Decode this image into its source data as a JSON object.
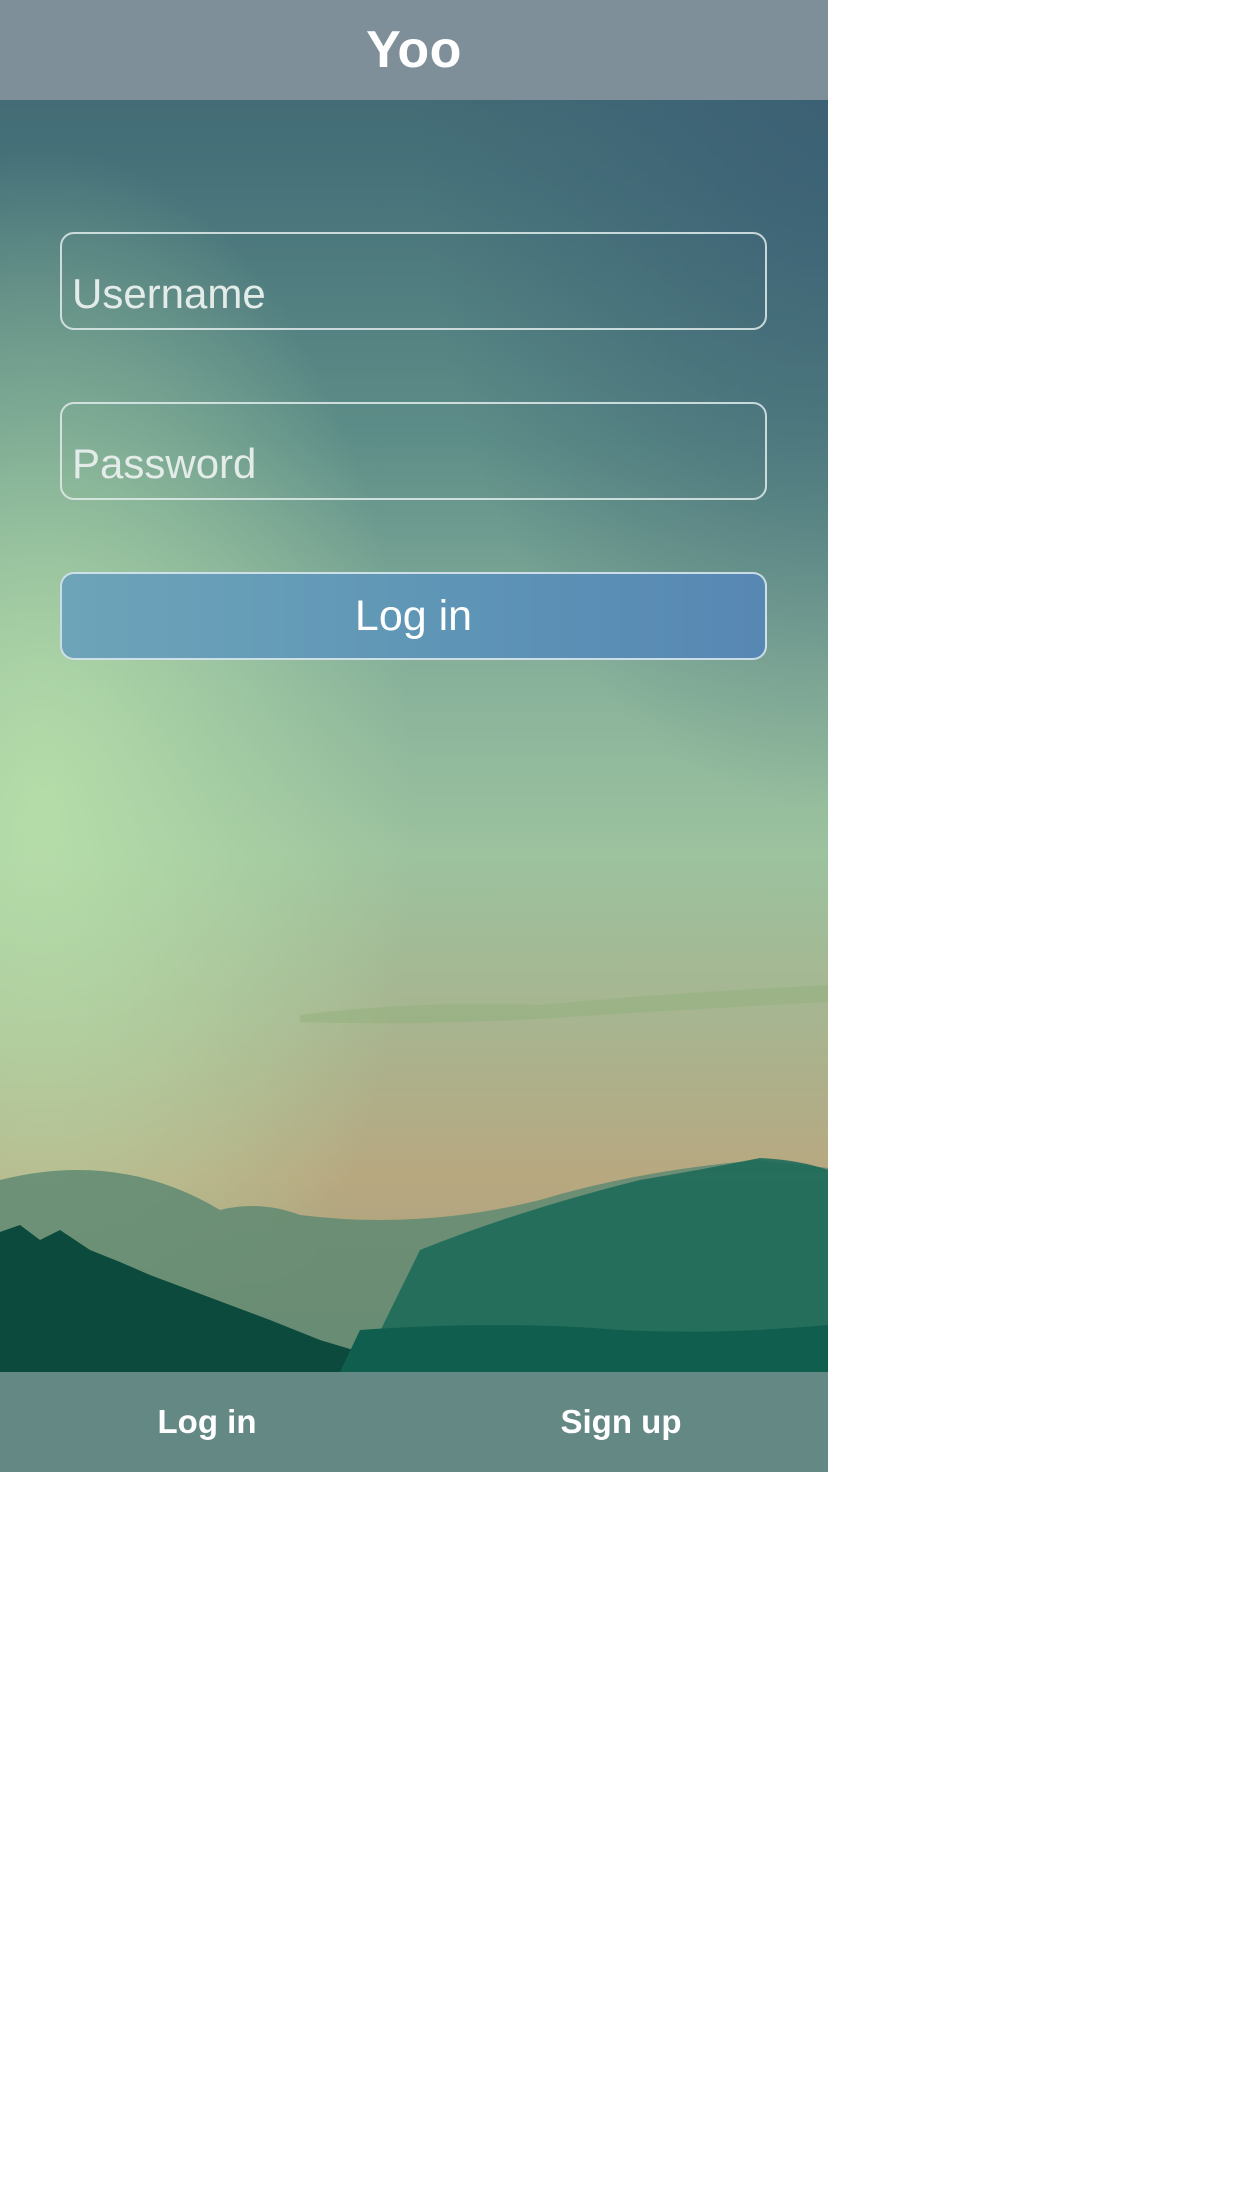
{
  "header": {
    "title": "Yoo"
  },
  "form": {
    "username": {
      "placeholder": "Username",
      "value": ""
    },
    "password": {
      "placeholder": "Password",
      "value": ""
    },
    "submit_label": "Log in"
  },
  "footer": {
    "tabs": [
      {
        "label": "Log in"
      },
      {
        "label": "Sign up"
      }
    ]
  },
  "colors": {
    "header_bg": "#7f8f99",
    "footer_bg": "#648884",
    "button_bg": "#5e95b6",
    "text": "#ffffff"
  }
}
